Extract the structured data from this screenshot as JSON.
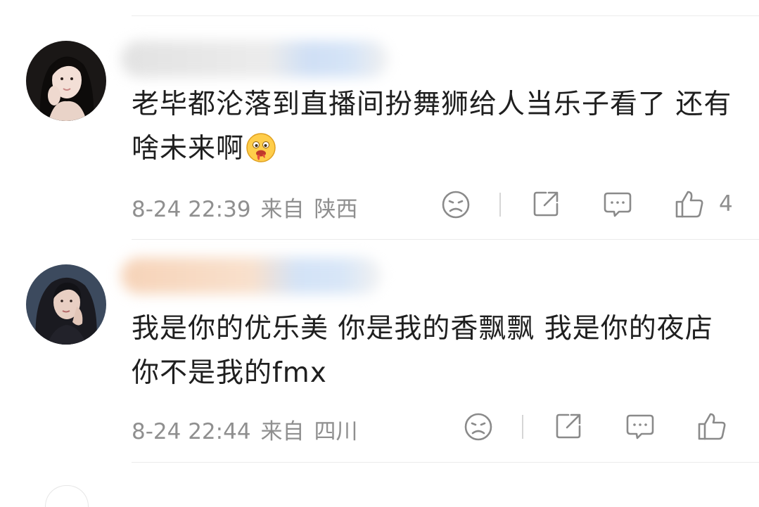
{
  "comments": [
    {
      "text": "老毕都沦落到直播间扮舞狮给人当乐子看了 还有啥未来啊",
      "emoji": "drooling-face-emoji",
      "date": "8-24 22:39",
      "from_label": "来自",
      "location": "陕西",
      "like_count": "4"
    },
    {
      "text": "我是你的优乐美 你是我的香飘飘 我是你的夜店 你不是我的fmx",
      "date": "8-24 22:44",
      "from_label": "来自",
      "location": "四川",
      "like_count": ""
    }
  ],
  "icons": {
    "dislike": "sad-face-icon",
    "share": "share-icon",
    "reply": "comment-icon",
    "like": "thumbs-up-icon"
  },
  "colors": {
    "text": "#1f1f1f",
    "meta": "#8f8f8f",
    "icon": "#8a8a8a"
  }
}
